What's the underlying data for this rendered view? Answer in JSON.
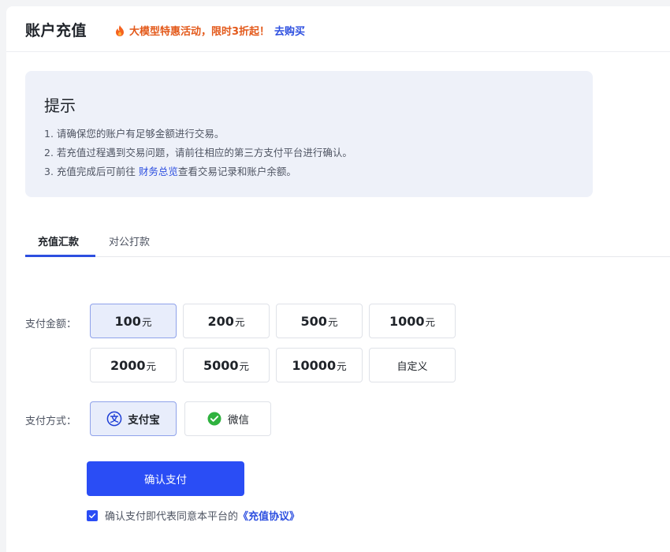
{
  "header": {
    "title": "账户充值",
    "promo_text": "大模型特惠活动，限时3折起！",
    "promo_link": "去购买"
  },
  "notice": {
    "title": "提示",
    "line1": "1. 请确保您的账户有足够金额进行交易。",
    "line2": "2. 若充值过程遇到交易问题，请前往相应的第三方支付平台进行确认。",
    "line3_prefix": "3. 充值完成后可前往 ",
    "line3_link": "财务总览",
    "line3_suffix": "查看交易记录和账户余额。"
  },
  "tabs": [
    {
      "label": "充值汇款",
      "active": true
    },
    {
      "label": "对公打款",
      "active": false
    }
  ],
  "amount": {
    "label": "支付金额：",
    "unit": "元",
    "options": [
      "100",
      "200",
      "500",
      "1000",
      "2000",
      "5000",
      "10000"
    ],
    "custom_label": "自定义",
    "selected": "100"
  },
  "method": {
    "label": "支付方式：",
    "options": [
      {
        "label": "支付宝",
        "icon": "alipay-icon",
        "selected": true
      },
      {
        "label": "微信",
        "icon": "wechat-icon",
        "selected": false
      }
    ]
  },
  "confirm_label": "确认支付",
  "agreement": {
    "checked": true,
    "text": "确认支付即代表同意本平台的",
    "link": "《充值协议》"
  },
  "colors": {
    "accent": "#2a4df5",
    "promo": "#e3591a",
    "link": "#2d4fe0",
    "selected_bg": "#e8edfb"
  }
}
